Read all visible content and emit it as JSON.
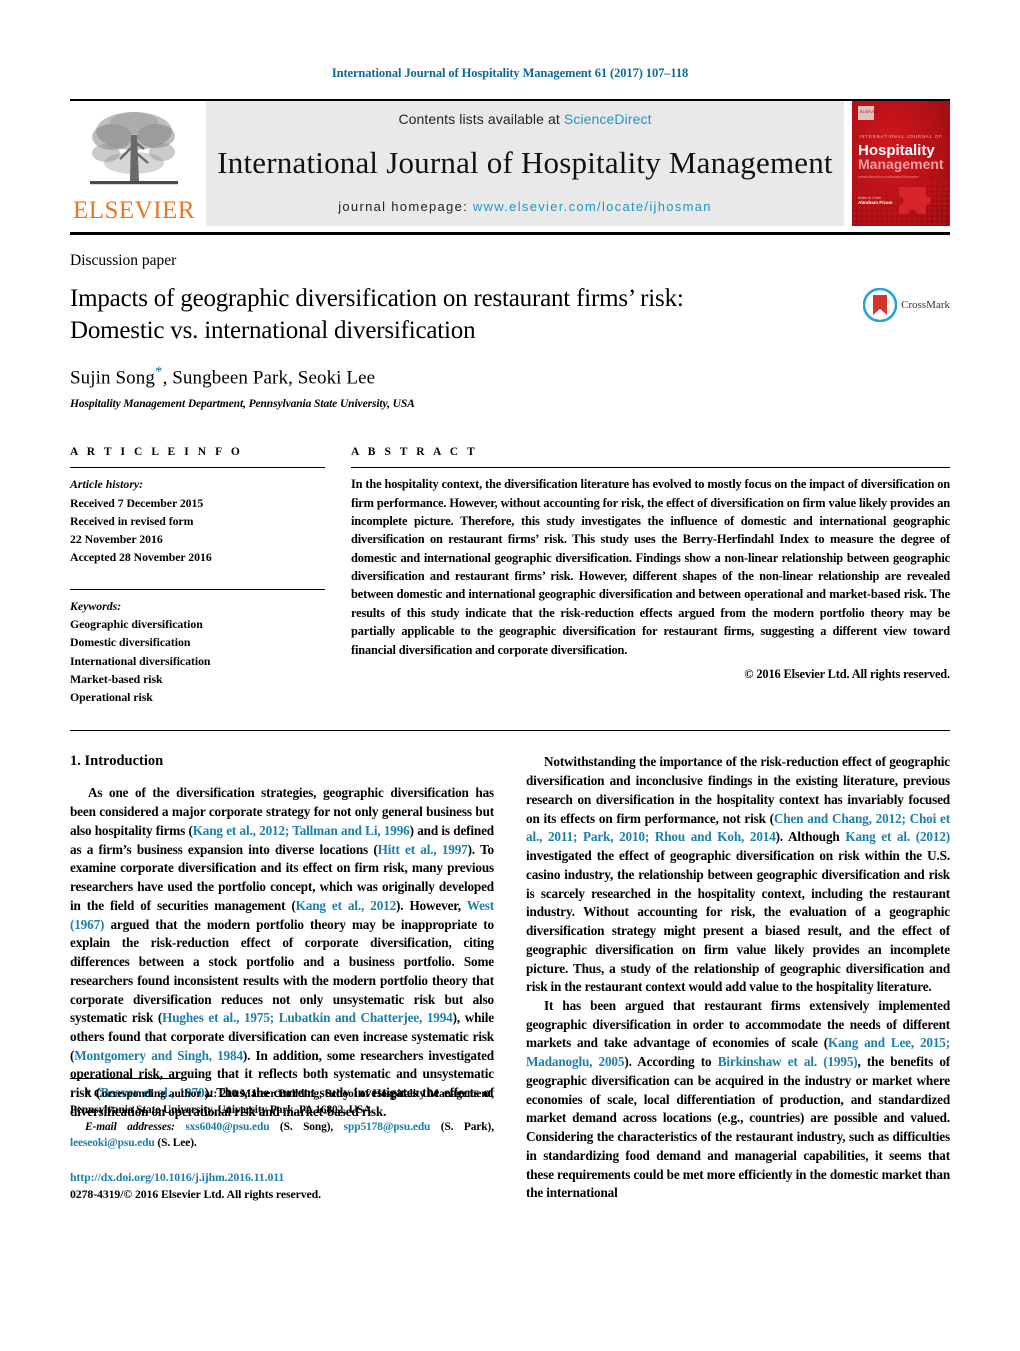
{
  "running_head": "International Journal of Hospitality Management 61 (2017) 107–118",
  "masthead": {
    "publisher_word": "ELSEVIER",
    "contents_prefix": "Contents lists available at ",
    "sciencedirect": "ScienceDirect",
    "journal_title": "International Journal of Hospitality Management",
    "homepage_prefix": "journal homepage: ",
    "homepage_url": "www.elsevier.com/locate/ijhosman",
    "cover_kicker": "INTERNATIONAL JOURNAL OF",
    "cover_line1": "Hospitality",
    "cover_line2": "Management",
    "cover_sub": "Editor in Chief",
    "cover_editor": "Abraham Pizam"
  },
  "article": {
    "doctype": "Discussion paper",
    "title_line1": "Impacts of geographic diversification on restaurant firms’ risk:",
    "title_line2": "Domestic vs. international diversification",
    "crossmark_label": "CrossMark",
    "authors": "Sujin Song",
    "authors_rest": ", Sungbeen Park, Seoki Lee",
    "affiliation": "Hospitality Management Department, Pennsylvania State University, USA"
  },
  "article_info": {
    "heading": "A R T I C L E    I N F O",
    "history_label": "Article history:",
    "history": [
      "Received 7 December 2015",
      "Received in revised form",
      "22 November 2016",
      "Accepted 28 November 2016"
    ],
    "keywords_label": "Keywords:",
    "keywords": [
      "Geographic diversification",
      "Domestic diversification",
      "International diversification",
      "Market-based risk",
      "Operational risk"
    ]
  },
  "abstract": {
    "heading": "A B S T R A C T",
    "text": "In the hospitality context, the diversification literature has evolved to mostly focus on the impact of diversification on firm performance. However, without accounting for risk, the effect of diversification on firm value likely provides an incomplete picture. Therefore, this study investigates the influence of domestic and international geographic diversification on restaurant firms’ risk. This study uses the Berry-Herfindahl Index to measure the degree of domestic and international geographic diversification. Findings show a non-linear relationship between geographic diversification and restaurant firms’ risk. However, different shapes of the non-linear relationship are revealed between domestic and international geographic diversification and between operational and market-based risk. The results of this study indicate that the risk-reduction effects argued from the modern portfolio theory may be partially applicable to the geographic diversification for restaurant firms, suggesting a different view toward financial diversification and corporate diversification.",
    "copyright": "© 2016 Elsevier Ltd. All rights reserved."
  },
  "body": {
    "section1_heading": "1.  Introduction",
    "left_para1_parts": [
      {
        "t": "As one of the diversification strategies, geographic diversification has been considered a major corporate strategy for not only general business but also hospitality firms (",
        "link": false
      },
      {
        "t": "Kang et al., 2012; Tallman and Li, 1996",
        "link": true
      },
      {
        "t": ") and is defined as a firm’s business expansion into diverse locations (",
        "link": false
      },
      {
        "t": "Hitt et al., 1997",
        "link": true
      },
      {
        "t": "). To examine corporate diversification and its effect on firm risk, many previous researchers have used the portfolio concept, which was originally developed in the field of securities management (",
        "link": false
      },
      {
        "t": "Kang et al., 2012",
        "link": true
      },
      {
        "t": "). However, ",
        "link": false
      },
      {
        "t": "West (1967)",
        "link": true
      },
      {
        "t": " argued that the modern portfolio theory may be inappropriate to explain the risk-reduction effect of corporate diversification, citing differences between a stock portfolio and a business portfolio. Some researchers found inconsistent results with the modern portfolio theory that corporate diversification reduces not only unsystematic risk but also systematic risk (",
        "link": false
      },
      {
        "t": "Hughes et al., 1975; Lubatkin and Chatterjee, 1994",
        "link": true
      },
      {
        "t": "), while others found that corporate diversification can even increase systematic risk (",
        "link": false
      },
      {
        "t": "Montgomery and Singh, 1984",
        "link": true
      },
      {
        "t": "). In addition, some researchers investigated operational risk, arguing that it reflects both systematic and unsystematic risk (",
        "link": false
      },
      {
        "t": "Beaver et al., 1970",
        "link": true
      },
      {
        "t": "). Thus, the current study investigates the effects of diversification on operational risk and market-based risk.",
        "link": false
      }
    ],
    "right_para1_parts": [
      {
        "t": "Notwithstanding the importance of the risk-reduction effect of geographic diversification and inconclusive findings in the existing literature, previous research on diversification in the hospitality context has invariably focused on its effects on firm performance, not risk (",
        "link": false
      },
      {
        "t": "Chen and Chang, 2012; Choi et al., 2011; Park, 2010; Rhou and Koh, 2014",
        "link": true
      },
      {
        "t": "). Although ",
        "link": false
      },
      {
        "t": "Kang et al. (2012)",
        "link": true
      },
      {
        "t": " investigated the effect of geographic diversification on risk within the U.S. casino industry, the relationship between geographic diversification and risk is scarcely researched in the hospitality context, including the restaurant industry. Without accounting for risk, the evaluation of a geographic diversification strategy might present a biased result, and the effect of geographic diversification on firm value likely provides an incomplete picture. Thus, a study of the relationship of geographic diversification and risk in the restaurant context would add value to the hospitality literature.",
        "link": false
      }
    ],
    "right_para2_parts": [
      {
        "t": "It has been argued that restaurant firms extensively implemented geographic diversification in order to accommodate the needs of different markets and take advantage of economies of scale (",
        "link": false
      },
      {
        "t": "Kang and Lee, 2015; Madanoglu, 2005",
        "link": true
      },
      {
        "t": "). According to ",
        "link": false
      },
      {
        "t": "Birkinshaw et al. (1995)",
        "link": true
      },
      {
        "t": ", the benefits of geographic diversification can be acquired in the industry or market where economies of scale, local differentiation of production, and standardized market demand across locations (e.g., countries) are possible and valued. Considering the characteristics of the restaurant industry, such as difficulties in standardizing food demand and managerial capabilities, it seems that these requirements could be met more efficiently in the domestic market than the international",
        "link": false
      }
    ]
  },
  "footnotes": {
    "corresponding": "* Corresponding author at: 210 Mateer Building, School of Hospitality Management, Pennsylvania State University, University Park, PA 16802, USA.",
    "email_label": "E-mail addresses:",
    "emails": [
      {
        "address": "sxs6040@psu.edu",
        "who": " (S. Song), "
      },
      {
        "address": "spp5178@psu.edu",
        "who": " (S. Park), "
      },
      {
        "address": "leeseoki@psu.edu",
        "who": " (S. Lee)."
      }
    ],
    "doi": "http://dx.doi.org/10.1016/j.ijhm.2016.11.011",
    "issn": "0278-4319/© 2016 Elsevier Ltd. All rights reserved."
  },
  "colors": {
    "link": "#1b7fa8",
    "header_blue": "#0b6a94",
    "elsevier_orange": "#E87722",
    "cover_red": "#b11016",
    "sciencedirect": "#2196c4"
  }
}
